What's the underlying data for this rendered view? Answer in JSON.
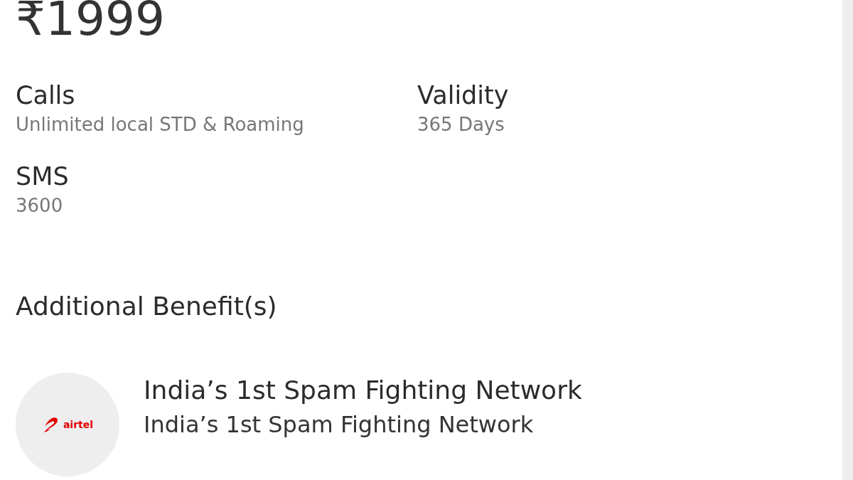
{
  "price": "₹1999",
  "benefits": [
    {
      "label": "Calls",
      "value": "Unlimited local STD & Roaming"
    },
    {
      "label": "Validity",
      "value": "365 Days"
    },
    {
      "label": "SMS",
      "value": "3600"
    }
  ],
  "additional": {
    "heading": "Additional Benefit(s)",
    "items": [
      {
        "logo_text": "airtel",
        "title": "India’s 1st Spam Fighting Network",
        "subtitle": "India’s 1st Spam Fighting Network"
      }
    ]
  }
}
